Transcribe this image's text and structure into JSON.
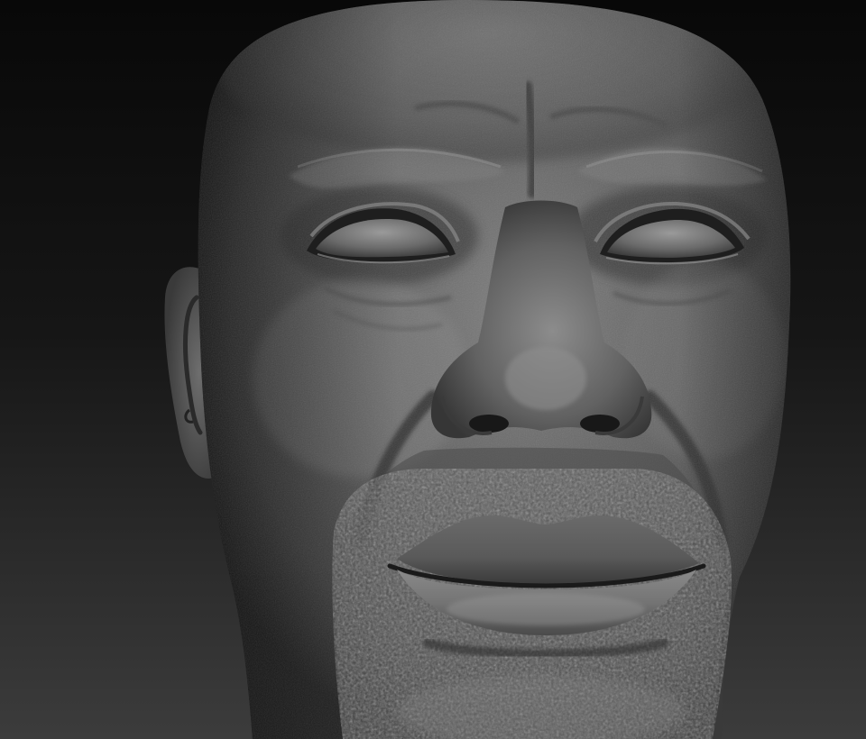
{
  "scene": {
    "subject": "sculpted-head",
    "colors": {
      "background_top": "#0b0b0b",
      "background_bottom": "#3a3a3a",
      "clay_light": "#8c8c8c",
      "clay_mid": "#5e5e5e",
      "clay_dark": "#2c2c2c",
      "clay_shadow": "#141414"
    }
  }
}
